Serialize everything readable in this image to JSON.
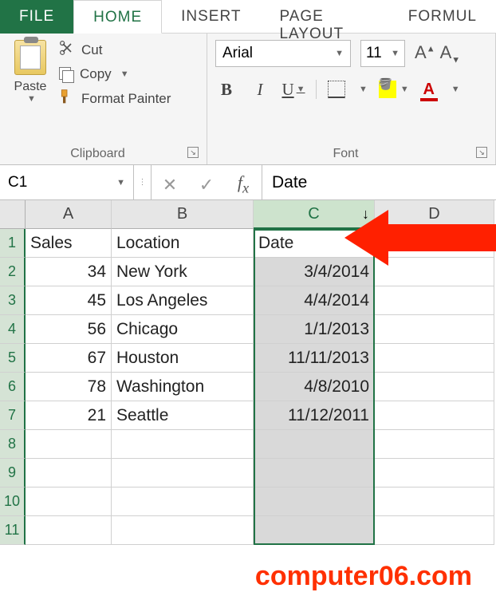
{
  "tabs": {
    "file": "FILE",
    "home": "HOME",
    "insert": "INSERT",
    "pagelayout": "PAGE LAYOUT",
    "formulas": "FORMUL"
  },
  "clipboard": {
    "paste": "Paste",
    "cut": "Cut",
    "copy": "Copy",
    "format_painter": "Format Painter",
    "group_label": "Clipboard"
  },
  "font": {
    "name": "Arial",
    "size": "11",
    "group_label": "Font"
  },
  "formula_bar": {
    "name_box": "C1",
    "value": "Date"
  },
  "columns": [
    "A",
    "B",
    "C",
    "D"
  ],
  "rowcount": 11,
  "chart_data": {
    "type": "table",
    "headers": [
      "Sales",
      "Location",
      "Date"
    ],
    "rows": [
      [
        34,
        "New York",
        "3/4/2014"
      ],
      [
        45,
        "Los Angeles",
        "4/4/2014"
      ],
      [
        56,
        "Chicago",
        "1/1/2013"
      ],
      [
        67,
        "Houston",
        "11/11/2013"
      ],
      [
        78,
        "Washington",
        "4/8/2010"
      ],
      [
        21,
        "Seattle",
        "11/12/2011"
      ]
    ]
  },
  "watermark": "computer06.com"
}
